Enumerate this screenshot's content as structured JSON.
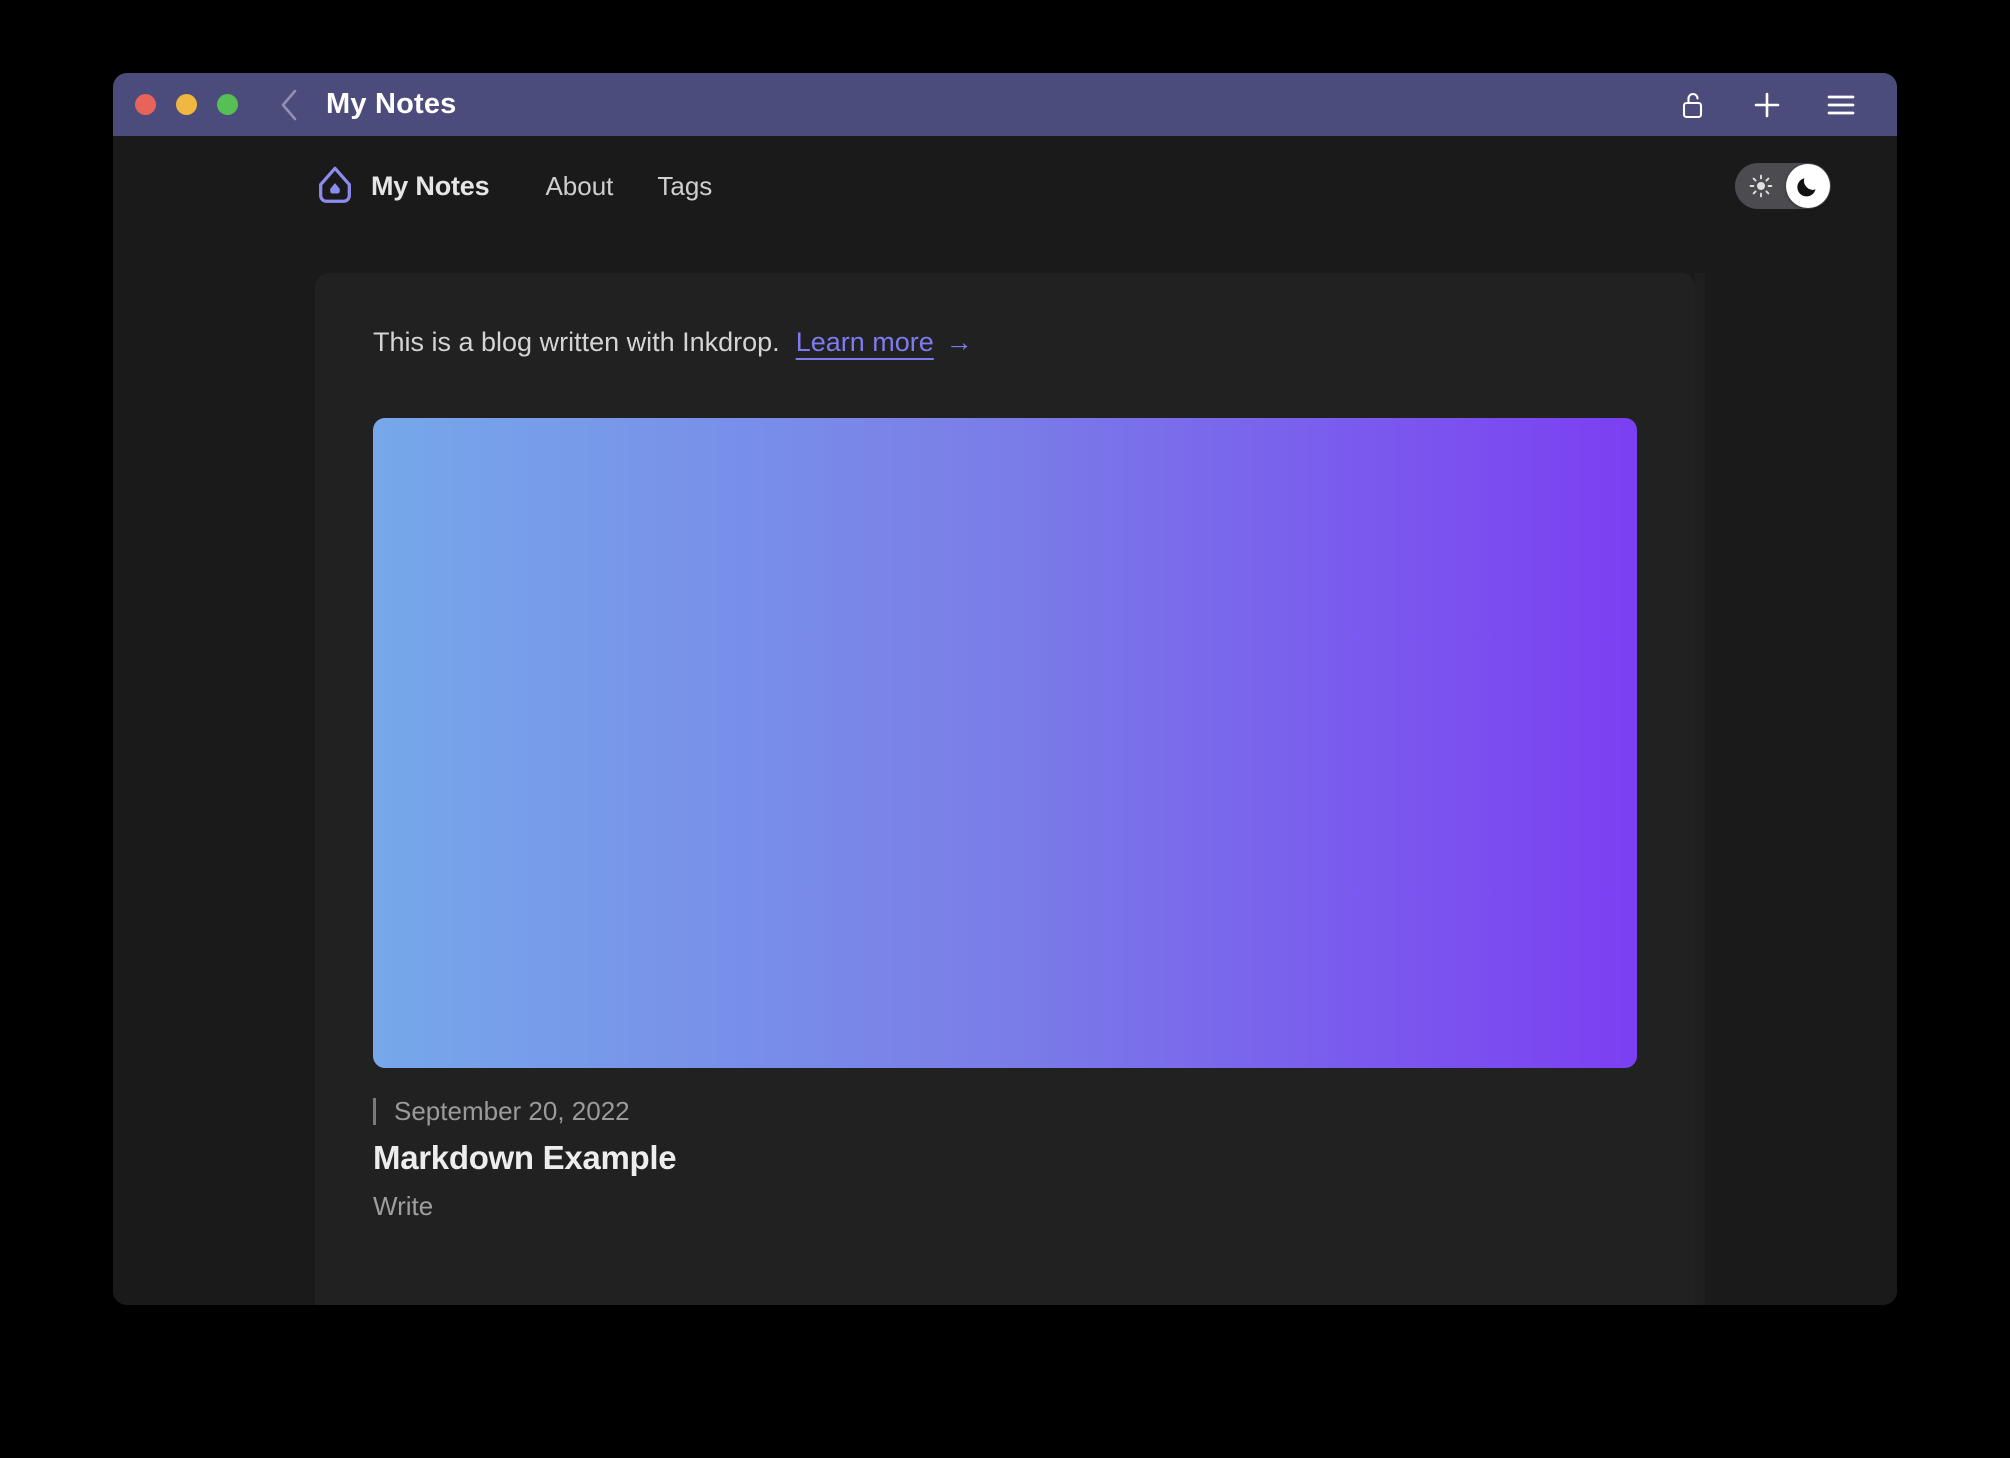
{
  "window": {
    "title": "My Notes",
    "traffic_lights": [
      {
        "name": "close",
        "color": "#e8645a"
      },
      {
        "name": "minimize",
        "color": "#f0b840"
      },
      {
        "name": "zoom",
        "color": "#56c055"
      }
    ],
    "back_icon": "chevron-left-icon",
    "actions": [
      {
        "name": "unlock-icon",
        "label": "Unlock"
      },
      {
        "name": "plus-icon",
        "label": "New"
      },
      {
        "name": "hamburger-menu-icon",
        "label": "Menu"
      }
    ],
    "titlebar_color": "#4c4c7c"
  },
  "site": {
    "brand": {
      "logo_icon": "inkdrop-logo-icon",
      "name": "My Notes",
      "logo_color": "#8b8cf0"
    },
    "nav_links": [
      {
        "label": "About"
      },
      {
        "label": "Tags"
      }
    ],
    "theme_toggle": {
      "state": "dark",
      "light_icon": "sun-icon",
      "dark_icon": "moon-icon",
      "track_color": "#4b4b50",
      "knob_color": "#ffffff"
    }
  },
  "notice": {
    "text": "This is a blog written with Inkdrop.",
    "link_label": "Learn more",
    "link_arrow": "→",
    "link_color": "#7d7bee"
  },
  "post": {
    "hero_gradient": {
      "from": "#76a8ea",
      "mid": "#7a7de8",
      "to": "#7b3ff2"
    },
    "date": "September 20, 2022",
    "title": "Markdown Example",
    "excerpt": "Write"
  }
}
